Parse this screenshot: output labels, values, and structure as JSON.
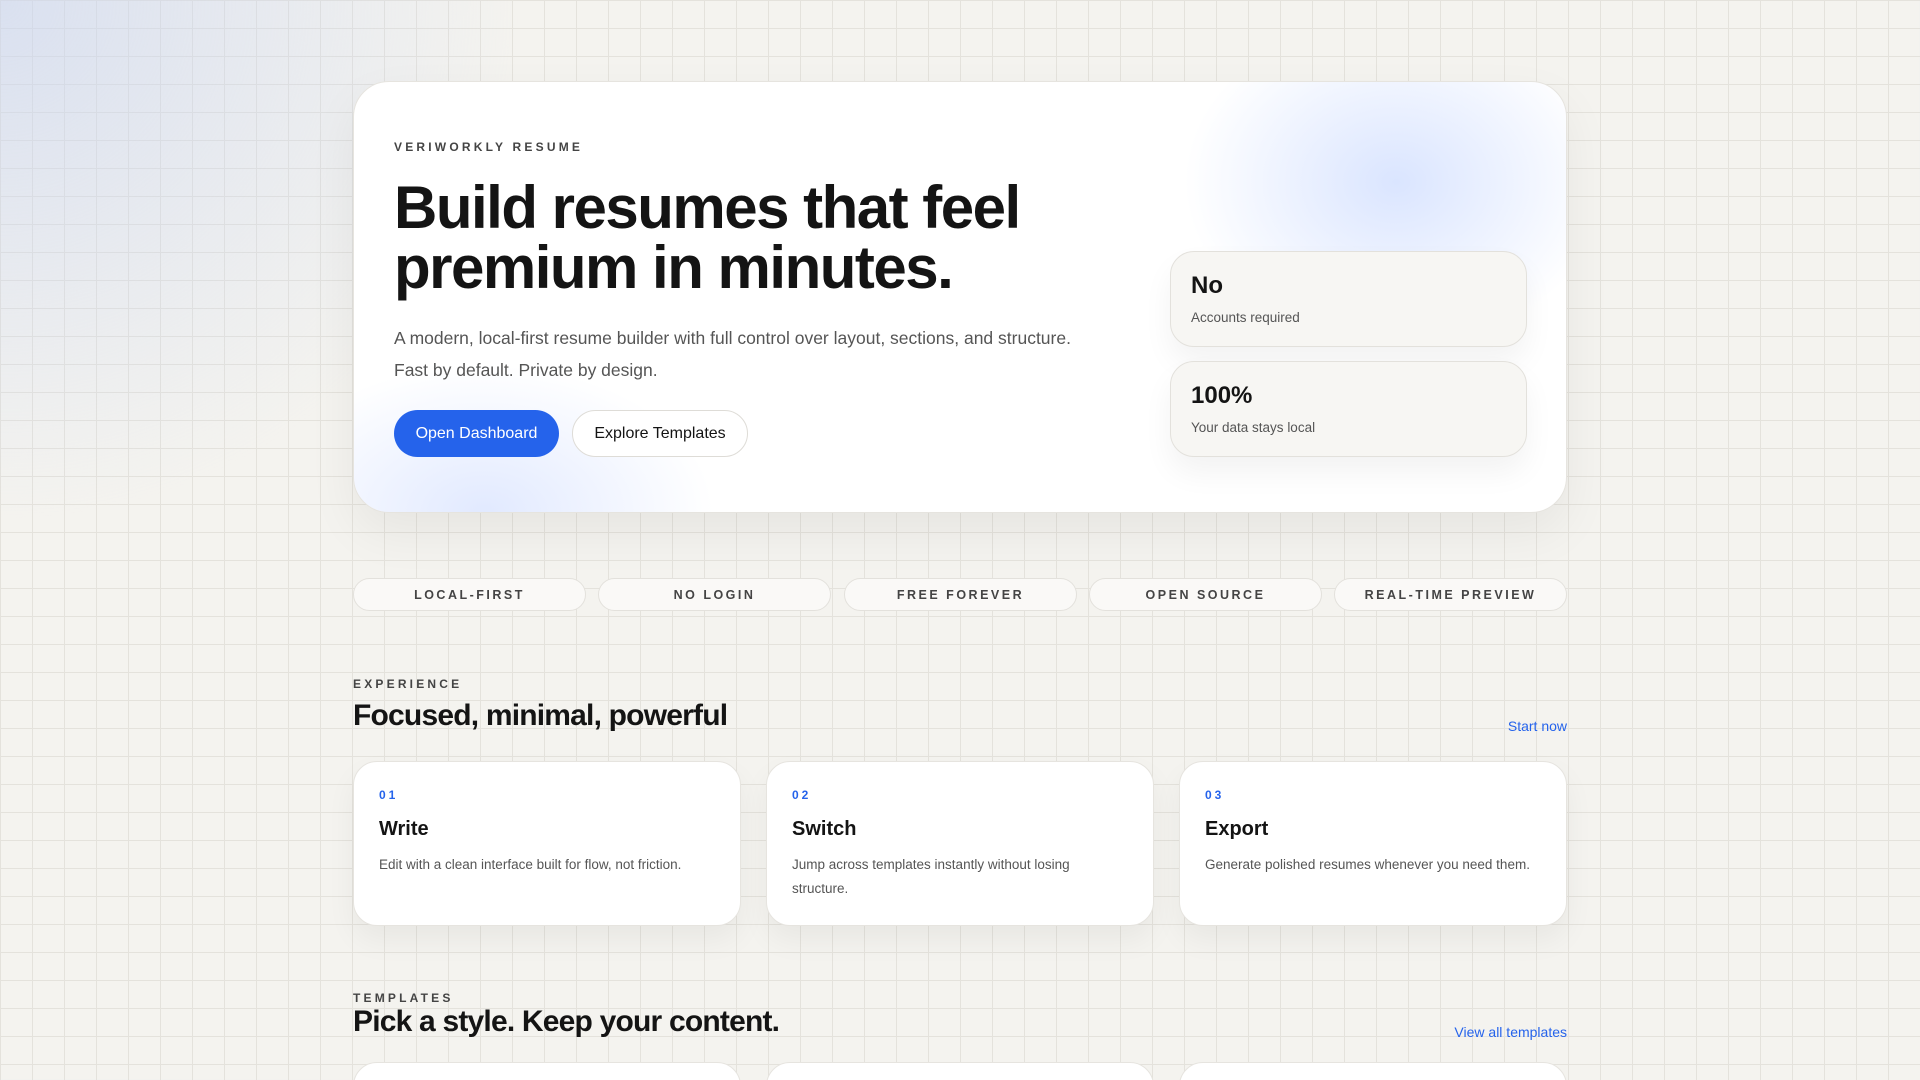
{
  "hero": {
    "eyebrow": "VERIWORKLY RESUME",
    "title_line1": "Build resumes that feel",
    "title_line2": "premium in minutes.",
    "lead": "A modern, local-first resume builder with full control over layout, sections, and structure. Fast by default. Private by design.",
    "primary_label": "Open Dashboard",
    "secondary_label": "Explore Templates",
    "stats": [
      {
        "value": "No",
        "label": "Accounts required"
      },
      {
        "value": "100%",
        "label": "Your data stays local"
      }
    ]
  },
  "pills": [
    "LOCAL-FIRST",
    "NO LOGIN",
    "FREE FOREVER",
    "OPEN SOURCE",
    "REAL-TIME PREVIEW"
  ],
  "experience": {
    "eyebrow": "EXPERIENCE",
    "title": "Focused, minimal, powerful",
    "link": "Start now",
    "cards": [
      {
        "num": "01",
        "title": "Write",
        "desc": "Edit with a clean interface built for flow, not friction."
      },
      {
        "num": "02",
        "title": "Switch",
        "desc": "Jump across templates instantly without losing structure."
      },
      {
        "num": "03",
        "title": "Export",
        "desc": "Generate polished resumes whenever you need them."
      }
    ]
  },
  "templates": {
    "eyebrow": "TEMPLATES",
    "title": "Pick a style. Keep your content.",
    "link": "View all templates"
  },
  "colors": {
    "accent": "#2563eb"
  }
}
